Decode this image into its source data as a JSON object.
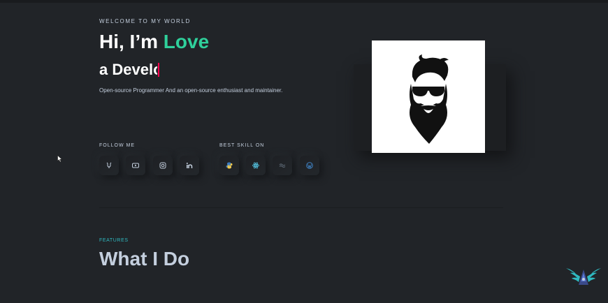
{
  "hero": {
    "welcome": "WELCOME TO MY WORLD",
    "greeting": "Hi, I’m ",
    "name": "Love",
    "typed_prefix": "a ",
    "typed_text": "Devel",
    "typed_partial_char": "o",
    "description": "Open-source Programmer And an open-source enthusiast and maintainer."
  },
  "social": {
    "label": "FOLLOW ME",
    "icons": [
      "github-icon",
      "youtube-icon",
      "instagram-icon",
      "linkedin-icon"
    ]
  },
  "skills": {
    "label": "BEST SKILL ON",
    "icons": [
      "python-icon",
      "react-icon",
      "tailwind-icon",
      "wordpress-icon"
    ]
  },
  "features": {
    "label": "FEATURES",
    "heading": "What I Do"
  },
  "colors": {
    "background": "#212428",
    "accent_name": "#2fd09b",
    "features_label": "#2fb9c0",
    "text": "#c4cfde",
    "caret": "#ff014f"
  }
}
